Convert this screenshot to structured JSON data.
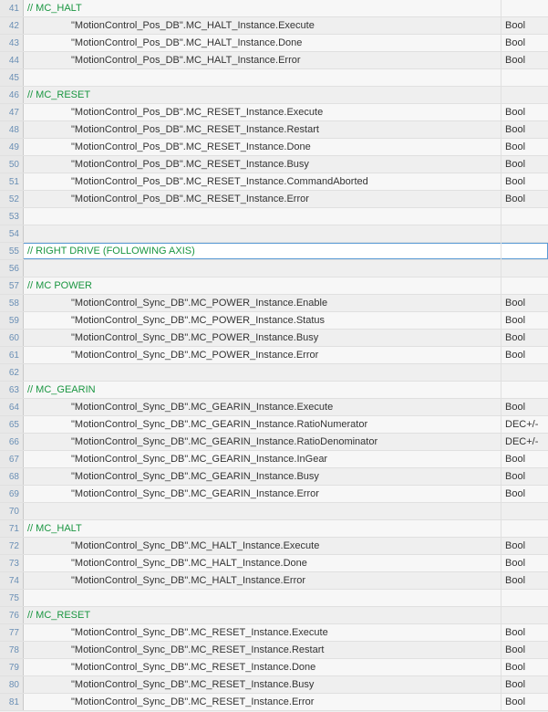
{
  "rows": [
    {
      "num": 41,
      "kind": "comment",
      "text": "// MC_HALT",
      "type": ""
    },
    {
      "num": 42,
      "kind": "code",
      "text": "\"MotionControl_Pos_DB\".MC_HALT_Instance.Execute",
      "type": "Bool"
    },
    {
      "num": 43,
      "kind": "code",
      "text": "\"MotionControl_Pos_DB\".MC_HALT_Instance.Done",
      "type": "Bool"
    },
    {
      "num": 44,
      "kind": "code",
      "text": "\"MotionControl_Pos_DB\".MC_HALT_Instance.Error",
      "type": "Bool"
    },
    {
      "num": 45,
      "kind": "blank",
      "text": "",
      "type": ""
    },
    {
      "num": 46,
      "kind": "comment",
      "text": "// MC_RESET",
      "type": ""
    },
    {
      "num": 47,
      "kind": "code",
      "text": "\"MotionControl_Pos_DB\".MC_RESET_Instance.Execute",
      "type": "Bool"
    },
    {
      "num": 48,
      "kind": "code",
      "text": "\"MotionControl_Pos_DB\".MC_RESET_Instance.Restart",
      "type": "Bool"
    },
    {
      "num": 49,
      "kind": "code",
      "text": "\"MotionControl_Pos_DB\".MC_RESET_Instance.Done",
      "type": "Bool"
    },
    {
      "num": 50,
      "kind": "code",
      "text": "\"MotionControl_Pos_DB\".MC_RESET_Instance.Busy",
      "type": "Bool"
    },
    {
      "num": 51,
      "kind": "code",
      "text": "\"MotionControl_Pos_DB\".MC_RESET_Instance.CommandAborted",
      "type": "Bool"
    },
    {
      "num": 52,
      "kind": "code",
      "text": "\"MotionControl_Pos_DB\".MC_RESET_Instance.Error",
      "type": "Bool"
    },
    {
      "num": 53,
      "kind": "blank",
      "text": "",
      "type": ""
    },
    {
      "num": 54,
      "kind": "blank",
      "text": "",
      "type": ""
    },
    {
      "num": 55,
      "kind": "comment",
      "text": "// RIGHT DRIVE (FOLLOWING AXIS)",
      "type": "",
      "selected": true
    },
    {
      "num": 56,
      "kind": "blank",
      "text": "",
      "type": ""
    },
    {
      "num": 57,
      "kind": "comment",
      "text": "// MC POWER",
      "type": ""
    },
    {
      "num": 58,
      "kind": "code",
      "text": "\"MotionControl_Sync_DB\".MC_POWER_Instance.Enable",
      "type": "Bool"
    },
    {
      "num": 59,
      "kind": "code",
      "text": "\"MotionControl_Sync_DB\".MC_POWER_Instance.Status",
      "type": "Bool"
    },
    {
      "num": 60,
      "kind": "code",
      "text": "\"MotionControl_Sync_DB\".MC_POWER_Instance.Busy",
      "type": "Bool"
    },
    {
      "num": 61,
      "kind": "code",
      "text": "\"MotionControl_Sync_DB\".MC_POWER_Instance.Error",
      "type": "Bool"
    },
    {
      "num": 62,
      "kind": "blank",
      "text": "",
      "type": ""
    },
    {
      "num": 63,
      "kind": "comment",
      "text": "// MC_GEARIN",
      "type": ""
    },
    {
      "num": 64,
      "kind": "code",
      "text": "\"MotionControl_Sync_DB\".MC_GEARIN_Instance.Execute",
      "type": "Bool"
    },
    {
      "num": 65,
      "kind": "code",
      "text": "\"MotionControl_Sync_DB\".MC_GEARIN_Instance.RatioNumerator",
      "type": "DEC+/-"
    },
    {
      "num": 66,
      "kind": "code",
      "text": "\"MotionControl_Sync_DB\".MC_GEARIN_Instance.RatioDenominator",
      "type": "DEC+/-"
    },
    {
      "num": 67,
      "kind": "code",
      "text": "\"MotionControl_Sync_DB\".MC_GEARIN_Instance.InGear",
      "type": "Bool"
    },
    {
      "num": 68,
      "kind": "code",
      "text": "\"MotionControl_Sync_DB\".MC_GEARIN_Instance.Busy",
      "type": "Bool"
    },
    {
      "num": 69,
      "kind": "code",
      "text": "\"MotionControl_Sync_DB\".MC_GEARIN_Instance.Error",
      "type": "Bool"
    },
    {
      "num": 70,
      "kind": "blank",
      "text": "",
      "type": ""
    },
    {
      "num": 71,
      "kind": "comment",
      "text": "// MC_HALT",
      "type": ""
    },
    {
      "num": 72,
      "kind": "code",
      "text": "\"MotionControl_Sync_DB\".MC_HALT_Instance.Execute",
      "type": "Bool"
    },
    {
      "num": 73,
      "kind": "code",
      "text": "\"MotionControl_Sync_DB\".MC_HALT_Instance.Done",
      "type": "Bool"
    },
    {
      "num": 74,
      "kind": "code",
      "text": "\"MotionControl_Sync_DB\".MC_HALT_Instance.Error",
      "type": "Bool"
    },
    {
      "num": 75,
      "kind": "blank",
      "text": "",
      "type": ""
    },
    {
      "num": 76,
      "kind": "comment",
      "text": "// MC_RESET",
      "type": ""
    },
    {
      "num": 77,
      "kind": "code",
      "text": "\"MotionControl_Sync_DB\".MC_RESET_Instance.Execute",
      "type": "Bool"
    },
    {
      "num": 78,
      "kind": "code",
      "text": "\"MotionControl_Sync_DB\".MC_RESET_Instance.Restart",
      "type": "Bool"
    },
    {
      "num": 79,
      "kind": "code",
      "text": "\"MotionControl_Sync_DB\".MC_RESET_Instance.Done",
      "type": "Bool"
    },
    {
      "num": 80,
      "kind": "code",
      "text": "\"MotionControl_Sync_DB\".MC_RESET_Instance.Busy",
      "type": "Bool"
    },
    {
      "num": 81,
      "kind": "code",
      "text": "\"MotionControl_Sync_DB\".MC_RESET_Instance.Error",
      "type": "Bool"
    }
  ]
}
